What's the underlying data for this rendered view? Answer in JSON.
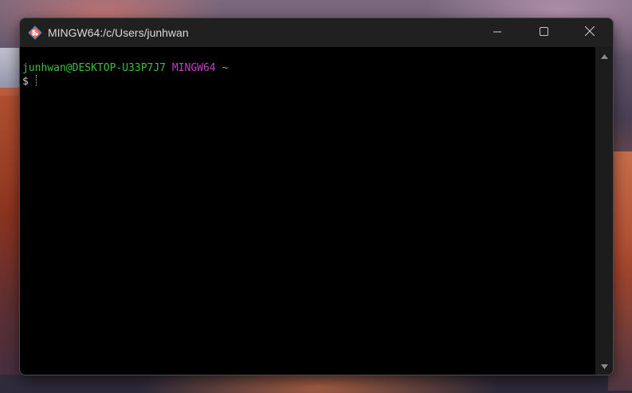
{
  "window": {
    "title": "MINGW64:/c/Users/junhwan",
    "app_icon": "git-bash-icon",
    "controls": [
      "minimize-icon",
      "maximize-icon",
      "close-icon"
    ]
  },
  "terminal": {
    "prompt": {
      "user_host": "junhwan@DESKTOP-U33P7J7",
      "env": "MINGW64",
      "path": "~",
      "symbol": "$"
    },
    "colors": {
      "background": "#000000",
      "user_host": "#3fbf3f",
      "env": "#c040c0",
      "path": "#c8a000",
      "text": "#d0d0d0"
    }
  },
  "scrollbar": {
    "up_icon": "scroll-up-arrow-icon",
    "down_icon": "scroll-down-arrow-icon"
  }
}
